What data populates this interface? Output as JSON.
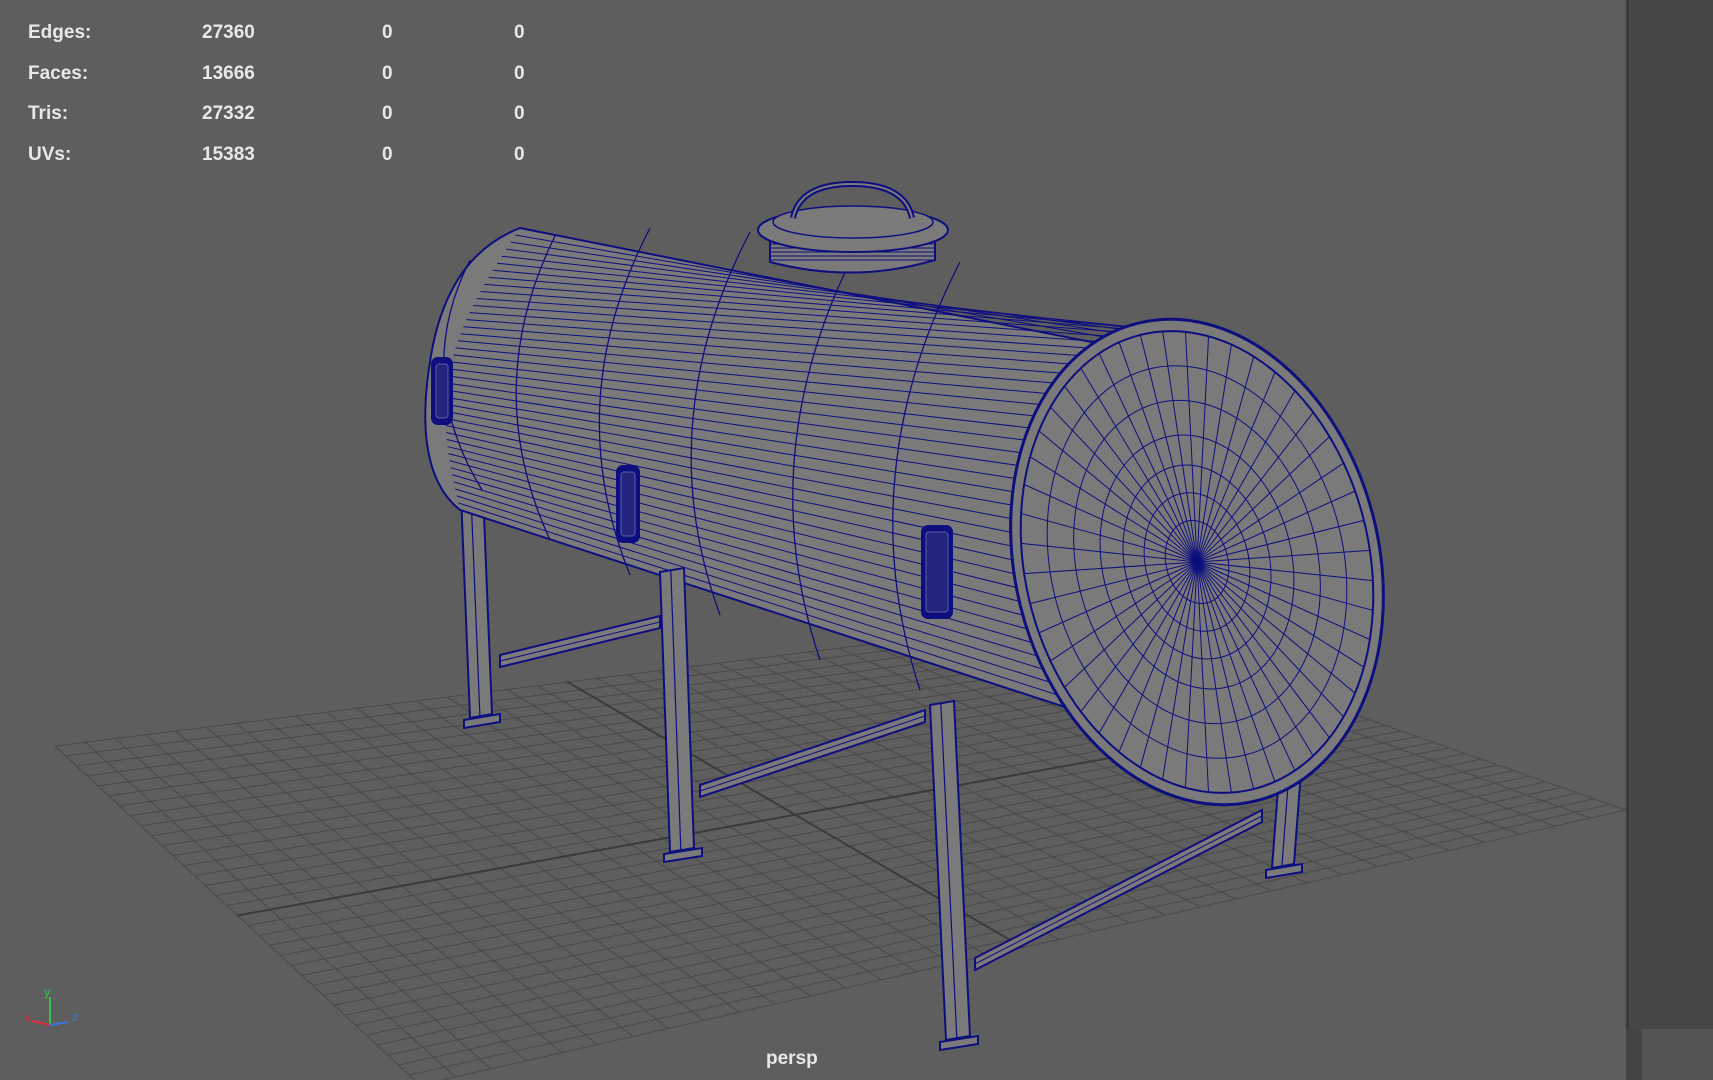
{
  "viewport": {
    "camera": "persp",
    "hud": {
      "rows": [
        {
          "label": "Edges:",
          "values": [
            "27360",
            "0",
            "0"
          ]
        },
        {
          "label": "Faces:",
          "values": [
            "13666",
            "0",
            "0"
          ]
        },
        {
          "label": "Tris:",
          "values": [
            "27332",
            "0",
            "0"
          ]
        },
        {
          "label": "UVs:",
          "values": [
            "15383",
            "0",
            "0"
          ]
        }
      ]
    },
    "axes": {
      "x": "x",
      "y": "y",
      "z": "z"
    }
  },
  "colors": {
    "wire": "#0e0f7e",
    "mesh_fill": "#7a7a7a",
    "grid": "#4a4a4a",
    "background": "#5e5e5e",
    "axis_x": "#d8303a",
    "axis_y": "#35c24a",
    "axis_z": "#3d72e0"
  }
}
